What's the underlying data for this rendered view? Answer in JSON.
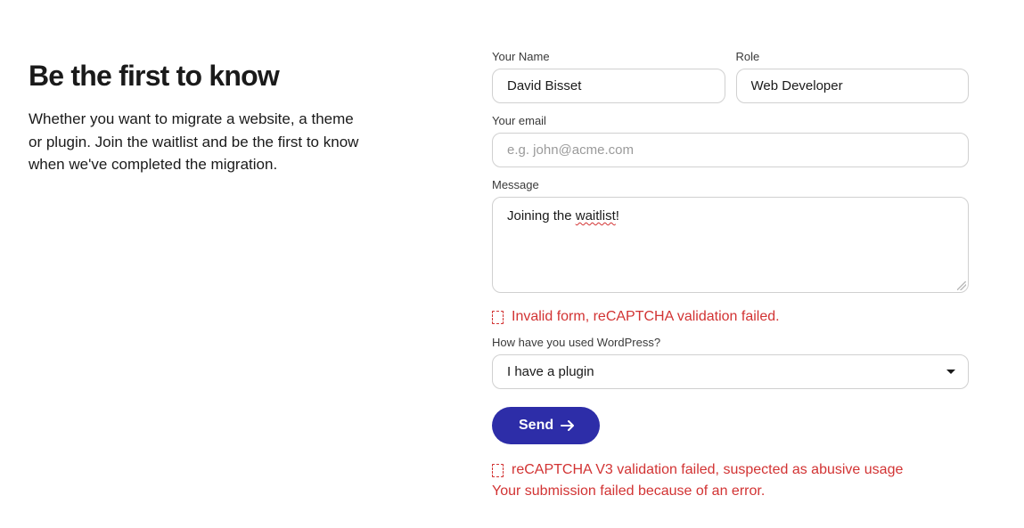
{
  "intro": {
    "heading": "Be the first to know",
    "body": "Whether you want to migrate a website, a theme or plugin. Join the waitlist and be the first to know when we've completed the migration."
  },
  "form": {
    "name": {
      "label": "Your Name",
      "value": "David Bisset"
    },
    "role": {
      "label": "Role",
      "value": "Web Developer"
    },
    "email": {
      "label": "Your email",
      "placeholder": "e.g. john@acme.com",
      "value": ""
    },
    "message": {
      "label": "Message",
      "value_pre": "Joining the ",
      "value_underlined": "waitlist",
      "value_post": "!"
    },
    "select": {
      "label": "How have you used WordPress?",
      "value": "I have a plugin"
    },
    "submit_label": "Send"
  },
  "errors": {
    "top": "Invalid form, reCAPTCHA validation failed.",
    "bottom1": "reCAPTCHA V3 validation failed, suspected as abusive usage",
    "bottom2": "Your submission failed because of an error."
  }
}
